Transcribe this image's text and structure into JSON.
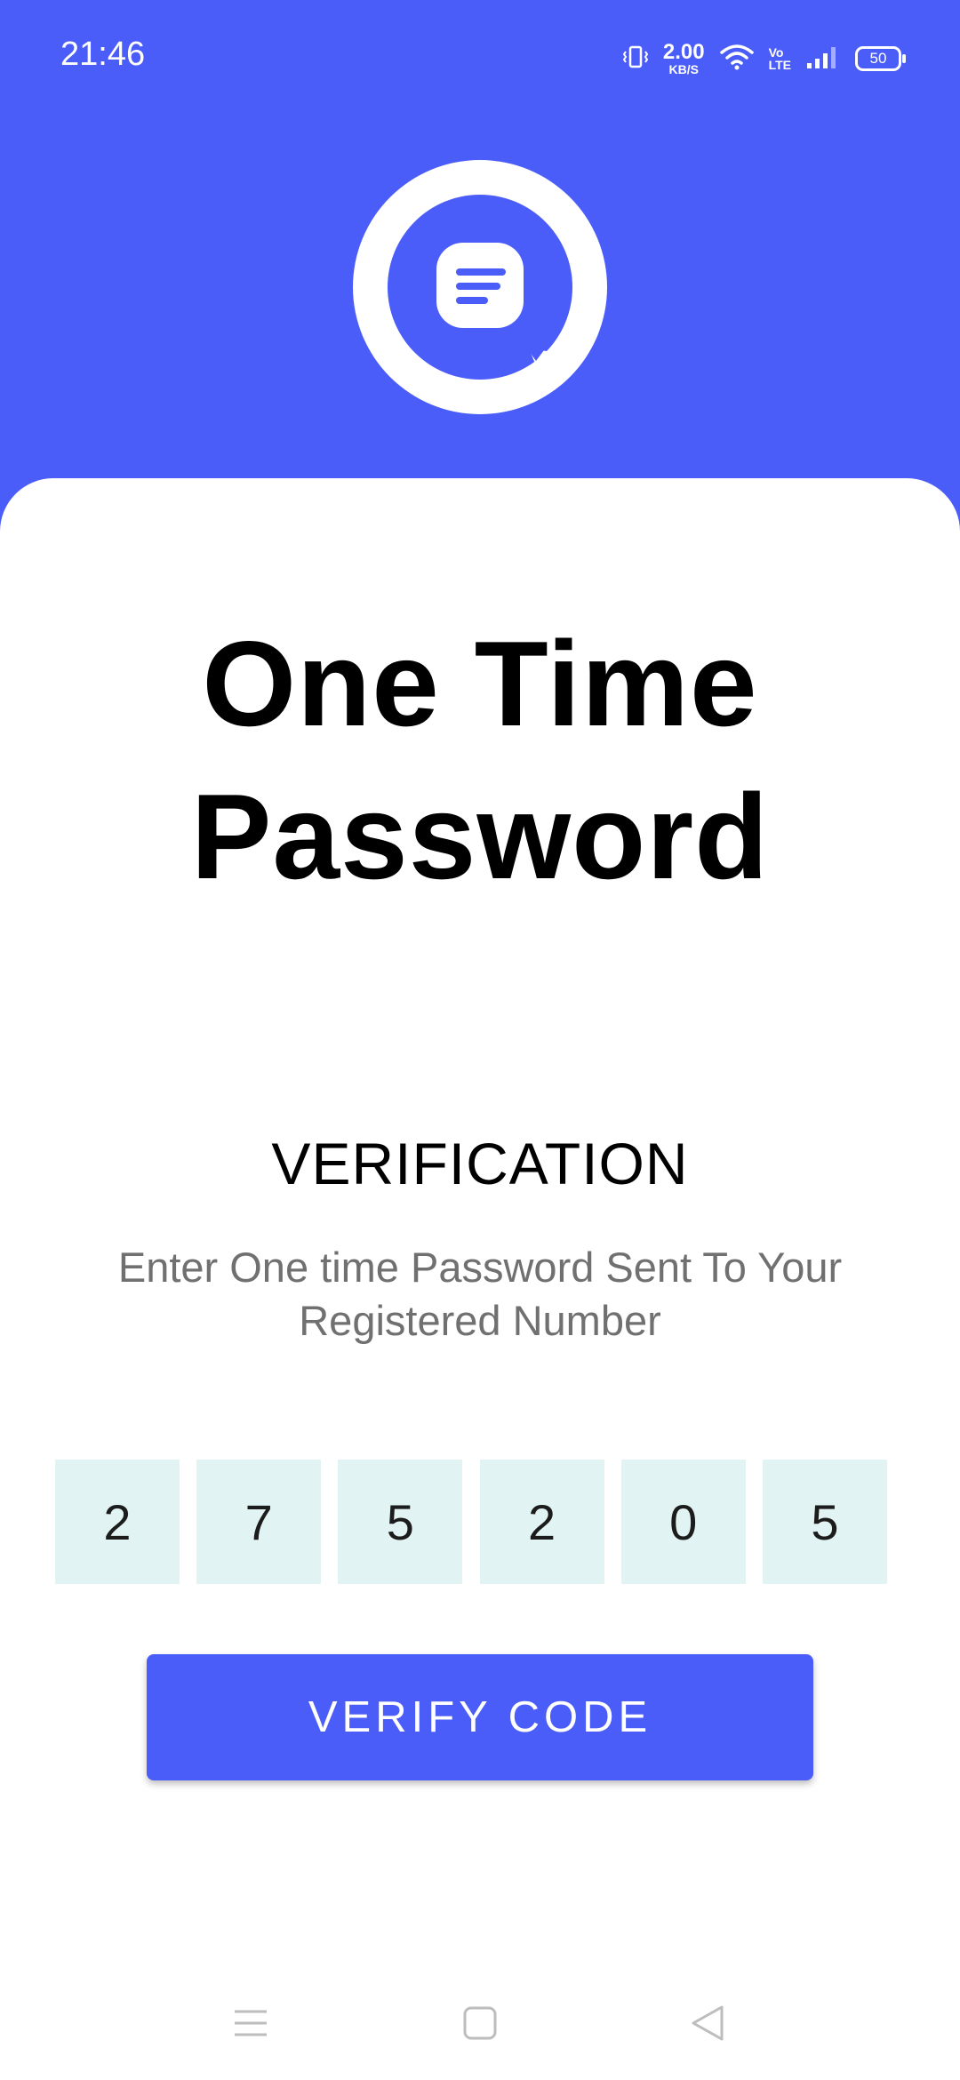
{
  "status_bar": {
    "time": "21:46",
    "net_speed_value": "2.00",
    "net_speed_unit": "KB/S",
    "volte_top": "Vo",
    "volte_bottom": "LTE",
    "battery_level": "50"
  },
  "colors": {
    "primary": "#4A5DF9",
    "otp_box_bg": "#E1F3F3",
    "subtitle_text": "#707070"
  },
  "header": {
    "logo_icon": "chat-bubble-message-icon"
  },
  "main": {
    "title": "One Time Password",
    "section_heading": "VERIFICATION",
    "instructions": "Enter One time Password Sent To Your Registered Number",
    "otp_digits": [
      "2",
      "7",
      "5",
      "2",
      "0",
      "5"
    ],
    "verify_button_label": "VERIFY CODE"
  },
  "nav_bar": {
    "icons": [
      "menu-icon",
      "home-icon",
      "back-icon"
    ]
  }
}
